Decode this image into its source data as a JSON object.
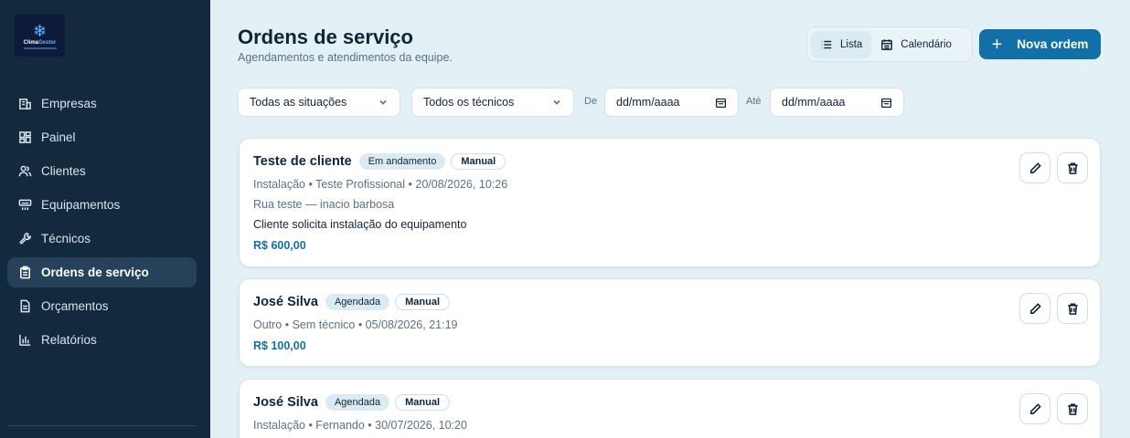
{
  "brand": {
    "name_part1": "Clima",
    "name_part2": "Gestor"
  },
  "sidebar": {
    "items": [
      {
        "label": "Empresas",
        "icon": "building-icon"
      },
      {
        "label": "Painel",
        "icon": "grid-icon"
      },
      {
        "label": "Clientes",
        "icon": "users-icon"
      },
      {
        "label": "Equipamentos",
        "icon": "air-conditioner-icon"
      },
      {
        "label": "Técnicos",
        "icon": "wrench-icon"
      },
      {
        "label": "Ordens de serviço",
        "icon": "clipboard-icon",
        "active": true
      },
      {
        "label": "Orçamentos",
        "icon": "document-icon"
      },
      {
        "label": "Relatórios",
        "icon": "bar-chart-icon"
      }
    ]
  },
  "header": {
    "title": "Ordens de serviço",
    "subtitle": "Agendamentos e atendimentos da equipe.",
    "view_list": "Lista",
    "view_calendar": "Calendário",
    "new_button": "Nova ordem"
  },
  "filters": {
    "status": "Todas as situações",
    "technician": "Todos os técnicos",
    "from_label": "De",
    "from_value": "dd/mm/aaaa",
    "to_label": "Até",
    "to_value": "dd/mm/aaaa"
  },
  "orders": [
    {
      "client": "Teste de cliente",
      "status": "Em andamento",
      "source": "Manual",
      "meta": "Instalação • Teste Profissional • 20/08/2026, 10:26",
      "address": "Rua teste — inacio barbosa",
      "description": "Cliente solicita instalação do equipamento",
      "price": "R$ 600,00"
    },
    {
      "client": "José Silva",
      "status": "Agendada",
      "source": "Manual",
      "meta": "Outro • Sem técnico • 05/08/2026, 21:19",
      "price": "R$ 100,00"
    },
    {
      "client": "José Silva",
      "status": "Agendada",
      "source": "Manual",
      "meta": "Instalação • Fernando • 30/07/2026, 10:20"
    }
  ],
  "colors": {
    "sidebar": "#132a3e",
    "accent": "#1270a8",
    "background": "#e3f0f6"
  }
}
